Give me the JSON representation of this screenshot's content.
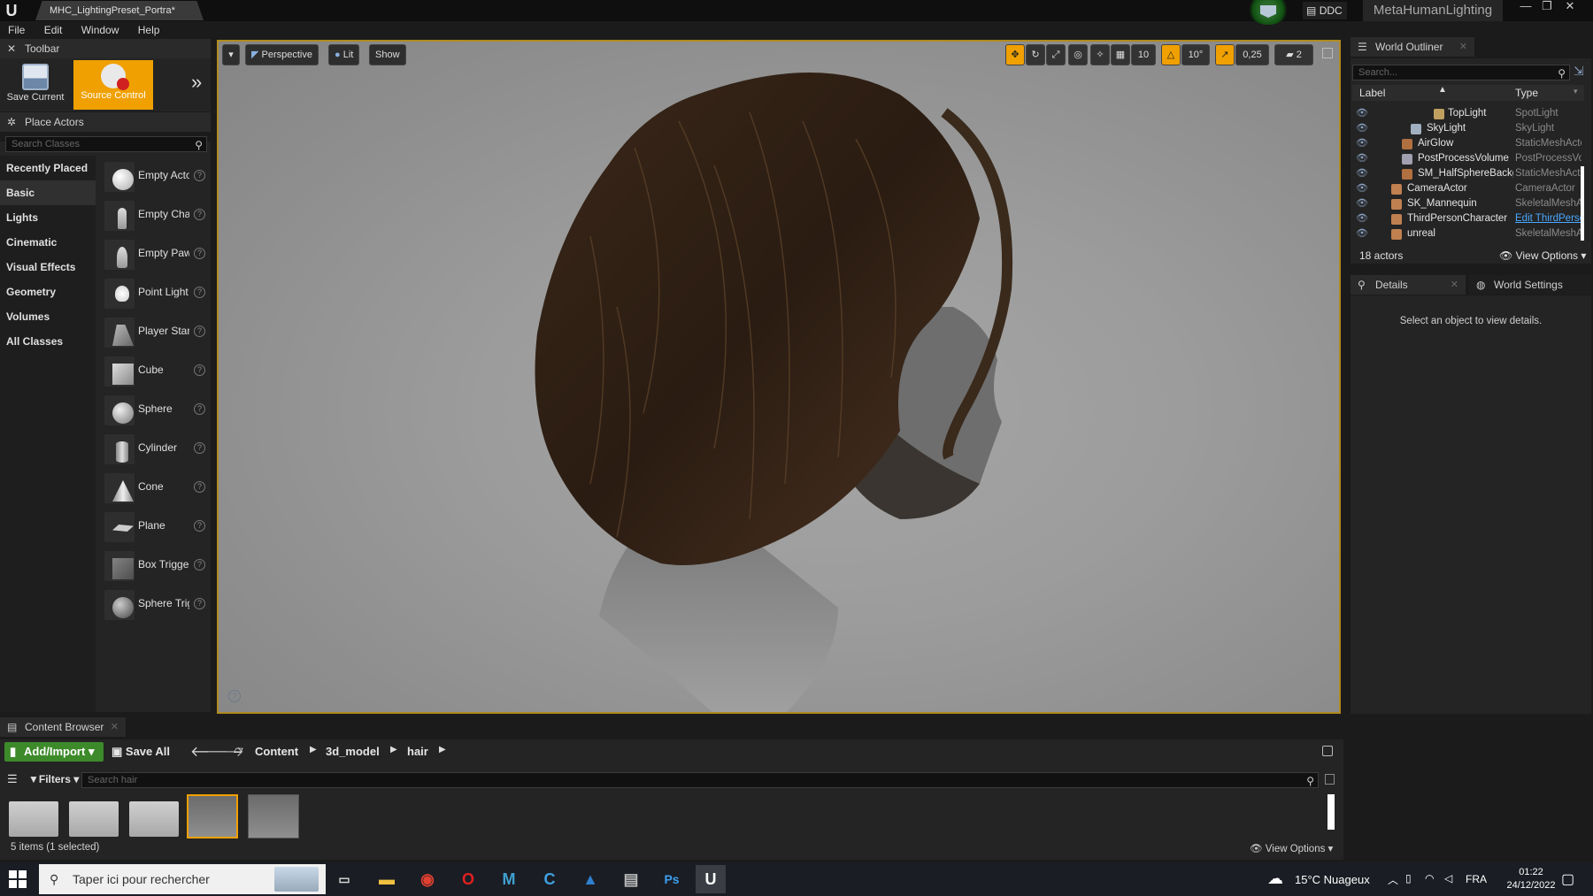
{
  "window": {
    "logo": "U",
    "doc_tab": "MHC_LightingPreset_Portra*",
    "ddc": "DDC",
    "project_name": "MetaHumanLighting",
    "controls": {
      "minimize": "—",
      "restore": "❐",
      "close": "✕"
    }
  },
  "menu": [
    "File",
    "Edit",
    "Window",
    "Help"
  ],
  "toolbar": {
    "tab_label": "Toolbar",
    "save_label": "Save Current",
    "source_control_label": "Source Control",
    "expand_glyph": "»"
  },
  "place_actors": {
    "tab_label": "Place Actors",
    "search_placeholder": "Search Classes",
    "categories": [
      "Recently Placed",
      "Basic",
      "Lights",
      "Cinematic",
      "Visual Effects",
      "Geometry",
      "Volumes",
      "All Classes"
    ],
    "selected_category": "Basic",
    "items": [
      {
        "label": "Empty Actor",
        "icon": "sphere-white-icon"
      },
      {
        "label": "Empty Character",
        "icon": "character-icon"
      },
      {
        "label": "Empty Pawn",
        "icon": "pawn-icon"
      },
      {
        "label": "Point Light",
        "icon": "lightbulb-icon"
      },
      {
        "label": "Player Start",
        "icon": "player-start-icon"
      },
      {
        "label": "Cube",
        "icon": "cube-icon"
      },
      {
        "label": "Sphere",
        "icon": "sphere-icon"
      },
      {
        "label": "Cylinder",
        "icon": "cylinder-icon"
      },
      {
        "label": "Cone",
        "icon": "cone-icon"
      },
      {
        "label": "Plane",
        "icon": "plane-icon"
      },
      {
        "label": "Box Trigger",
        "icon": "box-trigger-icon"
      },
      {
        "label": "Sphere Trigger",
        "icon": "sphere-trigger-icon"
      }
    ],
    "help_glyph": "?"
  },
  "viewport": {
    "dropdown_glyph": "▾",
    "perspective": "Perspective",
    "lit": "Lit",
    "show": "Show",
    "grid_snap": "10",
    "rotation_snap": "10°",
    "scale_snap": "0,25",
    "camera_speed": "2",
    "help_glyph": "?"
  },
  "outliner": {
    "tab_label": "World Outliner",
    "search_placeholder": "Search...",
    "col_label": "Label",
    "col_type": "Type",
    "rows": [
      {
        "label": "TopLight",
        "type": "SpotLight"
      },
      {
        "label": "SkyLight",
        "type": "SkyLight"
      },
      {
        "label": "AirGlow",
        "type": "StaticMeshActor"
      },
      {
        "label": "PostProcessVolume",
        "type": "PostProcessVolume"
      },
      {
        "label": "SM_HalfSphereBackground",
        "type": "StaticMeshActor"
      },
      {
        "label": "CameraActor",
        "type": "CameraActor"
      },
      {
        "label": "SK_Mannequin",
        "type": "SkeletalMeshActor"
      },
      {
        "label": "ThirdPersonCharacter",
        "type": "Edit ThirdPersonCharacter"
      },
      {
        "label": "unreal",
        "type": "SkeletalMeshActor"
      }
    ],
    "count": "18 actors",
    "view_options": "View Options"
  },
  "details": {
    "tab_details": "Details",
    "tab_world_settings": "World Settings",
    "empty_message": "Select an object to view details."
  },
  "content_browser": {
    "tab_label": "Content Browser",
    "add_import": "Add/Import",
    "save_all": "Save All",
    "path": [
      "Content",
      "3d_model",
      "hair"
    ],
    "filters": "Filters",
    "search_placeholder": "Search hair",
    "status": "5 items (1 selected)",
    "view_options": "View Options"
  },
  "taskbar": {
    "search_placeholder": "Taper ici pour rechercher",
    "weather": "15°C  Nuageux",
    "lang": "FRA",
    "time": "01:22",
    "date": "24/12/2022"
  },
  "colors": {
    "accent_orange": "#f0a000",
    "add_import_green": "#3d8a2a",
    "viewport_border": "#b08a20"
  }
}
